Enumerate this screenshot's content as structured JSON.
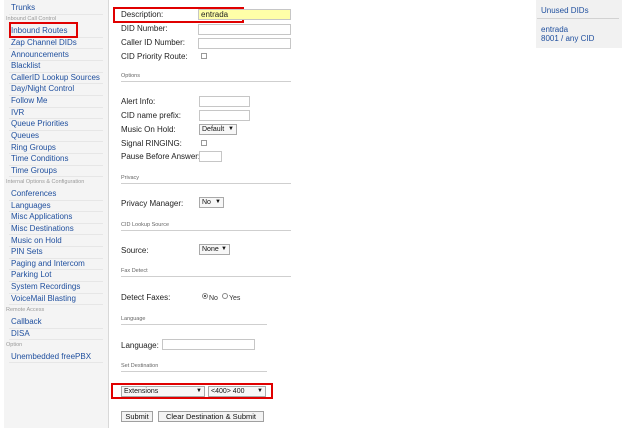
{
  "sidebar": {
    "items": [
      {
        "label": "Trunks",
        "type": "link"
      },
      {
        "label": "Inbound Call Control",
        "type": "section"
      },
      {
        "label": "Inbound Routes",
        "type": "link"
      },
      {
        "label": "Zap Channel DIDs",
        "type": "link"
      },
      {
        "label": "Announcements",
        "type": "link"
      },
      {
        "label": "Blacklist",
        "type": "link"
      },
      {
        "label": "CallerID Lookup Sources",
        "type": "link"
      },
      {
        "label": "Day/Night Control",
        "type": "link"
      },
      {
        "label": "Follow Me",
        "type": "link"
      },
      {
        "label": "IVR",
        "type": "link"
      },
      {
        "label": "Queue Priorities",
        "type": "link"
      },
      {
        "label": "Queues",
        "type": "link"
      },
      {
        "label": "Ring Groups",
        "type": "link"
      },
      {
        "label": "Time Conditions",
        "type": "link"
      },
      {
        "label": "Time Groups",
        "type": "link"
      },
      {
        "label": "Internal Options & Configuration",
        "type": "section"
      },
      {
        "label": "Conferences",
        "type": "link"
      },
      {
        "label": "Languages",
        "type": "link"
      },
      {
        "label": "Misc Applications",
        "type": "link"
      },
      {
        "label": "Misc Destinations",
        "type": "link"
      },
      {
        "label": "Music on Hold",
        "type": "link"
      },
      {
        "label": "PIN Sets",
        "type": "link"
      },
      {
        "label": "Paging and Intercom",
        "type": "link"
      },
      {
        "label": "Parking Lot",
        "type": "link"
      },
      {
        "label": "System Recordings",
        "type": "link"
      },
      {
        "label": "VoiceMail Blasting",
        "type": "link"
      },
      {
        "label": "Remote Access",
        "type": "section"
      },
      {
        "label": "Callback",
        "type": "link"
      },
      {
        "label": "DISA",
        "type": "link"
      },
      {
        "label": "Option",
        "type": "section"
      },
      {
        "label": "Unembedded freePBX",
        "type": "link"
      }
    ]
  },
  "form": {
    "description_label": "Description:",
    "description_value": "entrada",
    "did_number_label": "DID Number:",
    "did_number_value": "",
    "caller_id_label": "Caller ID Number:",
    "caller_id_value": "",
    "cid_priority_label": "CID Priority Route:",
    "options_section": "Options",
    "alert_info_label": "Alert Info:",
    "alert_info_value": "",
    "cid_prefix_label": "CID name prefix:",
    "cid_prefix_value": "",
    "music_on_hold_label": "Music On Hold:",
    "music_on_hold_value": "Default",
    "signal_ringing_label": "Signal RINGING:",
    "pause_label": "Pause Before Answer:",
    "pause_value": "",
    "privacy_section": "Privacy",
    "privacy_manager_label": "Privacy Manager:",
    "privacy_manager_value": "No",
    "cid_lookup_section": "CID Lookup Source",
    "source_label": "Source:",
    "source_value": "None",
    "fax_section": "Fax Detect",
    "detect_faxes_label": "Detect Faxes:",
    "detect_faxes_no": "No",
    "detect_faxes_yes": "Yes",
    "detect_faxes_selected": "No",
    "language_section": "Language",
    "language_label": "Language:",
    "language_value": "",
    "destination_section": "Set Destination",
    "destination_type": "Extensions",
    "destination_value": "<400> 400",
    "submit_label": "Submit",
    "clear_submit_label": "Clear Destination & Submit"
  },
  "right_panel": {
    "title": "Unused DIDs",
    "route_name": "entrada",
    "route_detail": "8001 / any CID"
  },
  "colors": {
    "link": "#1f4f9e",
    "highlight_box": "#e00000",
    "description_bg": "#ffffa8"
  }
}
